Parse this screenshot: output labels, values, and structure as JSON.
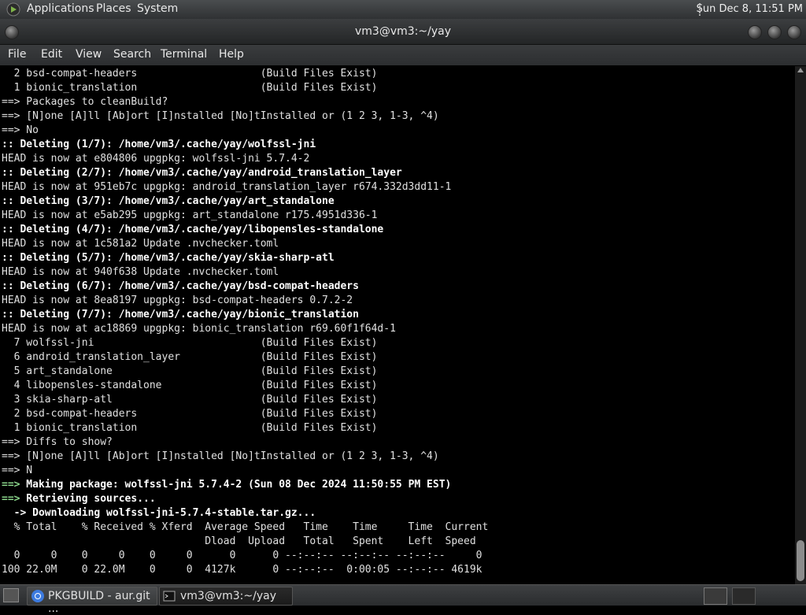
{
  "top_panel": {
    "menus": [
      "Applications",
      "Places",
      "System"
    ],
    "clock": "Sun Dec  8, 11:51 PM"
  },
  "window": {
    "title": "vm3@vm3:~/yay"
  },
  "menubar": [
    "File",
    "Edit",
    "View",
    "Search",
    "Terminal",
    "Help"
  ],
  "terminal": {
    "lines": [
      {
        "t": "  2 bsd-compat-headers                    (Build Files Exist)"
      },
      {
        "t": "  1 bionic_translation                    (Build Files Exist)"
      },
      {
        "t": "==> Packages to cleanBuild?"
      },
      {
        "t": "==> [N]one [A]ll [Ab]ort [I]nstalled [No]tInstalled or (1 2 3, 1-3, ^4)"
      },
      {
        "t": "==> No"
      },
      {
        "b": ":: Deleting (1/7): /home/vm3/.cache/yay/wolfssl-jni"
      },
      {
        "t": "HEAD is now at e804806 upgpkg: wolfssl-jni 5.7.4-2"
      },
      {
        "b": ":: Deleting (2/7): /home/vm3/.cache/yay/android_translation_layer"
      },
      {
        "t": "HEAD is now at 951eb7c upgpkg: android_translation_layer r674.332d3dd11-1"
      },
      {
        "b": ":: Deleting (3/7): /home/vm3/.cache/yay/art_standalone"
      },
      {
        "t": "HEAD is now at e5ab295 upgpkg: art_standalone r175.4951d336-1"
      },
      {
        "b": ":: Deleting (4/7): /home/vm3/.cache/yay/libopensles-standalone"
      },
      {
        "t": "HEAD is now at 1c581a2 Update .nvchecker.toml"
      },
      {
        "b": ":: Deleting (5/7): /home/vm3/.cache/yay/skia-sharp-atl"
      },
      {
        "t": "HEAD is now at 940f638 Update .nvchecker.toml"
      },
      {
        "b": ":: Deleting (6/7): /home/vm3/.cache/yay/bsd-compat-headers"
      },
      {
        "t": "HEAD is now at 8ea8197 upgpkg: bsd-compat-headers 0.7.2-2"
      },
      {
        "b": ":: Deleting (7/7): /home/vm3/.cache/yay/bionic_translation"
      },
      {
        "t": "HEAD is now at ac18869 upgpkg: bionic_translation r69.60f1f64d-1"
      },
      {
        "t": "  7 wolfssl-jni                           (Build Files Exist)"
      },
      {
        "t": "  6 android_translation_layer             (Build Files Exist)"
      },
      {
        "t": "  5 art_standalone                        (Build Files Exist)"
      },
      {
        "t": "  4 libopensles-standalone                (Build Files Exist)"
      },
      {
        "t": "  3 skia-sharp-atl                        (Build Files Exist)"
      },
      {
        "t": "  2 bsd-compat-headers                    (Build Files Exist)"
      },
      {
        "t": "  1 bionic_translation                    (Build Files Exist)"
      },
      {
        "t": "==> Diffs to show?"
      },
      {
        "t": "==> [N]one [A]ll [Ab]ort [I]nstalled [No]tInstalled or (1 2 3, 1-3, ^4)"
      },
      {
        "t": "==> N"
      },
      {
        "a": "==>",
        "b": " Making package: wolfssl-jni 5.7.4-2 (Sun 08 Dec 2024 11:50:55 PM EST)"
      },
      {
        "a": "==>",
        "b": " Retrieving sources..."
      },
      {
        "b": "  -> Downloading wolfssl-jni-5.7.4-stable.tar.gz..."
      },
      {
        "t": "  % Total    % Received % Xferd  Average Speed   Time    Time     Time  Current"
      },
      {
        "t": "                                 Dload  Upload   Total   Spent    Left  Speed"
      },
      {
        "t": "  0     0    0     0    0     0      0      0 --:--:-- --:--:-- --:--:--     0"
      },
      {
        "t": "100 22.0M    0 22.0M    0     0  4127k      0 --:--:--  0:00:05 --:--:-- 4619k"
      }
    ]
  },
  "taskbar": {
    "tasks": [
      "PKGBUILD - aur.git ...",
      "vm3@vm3:~/yay"
    ]
  }
}
